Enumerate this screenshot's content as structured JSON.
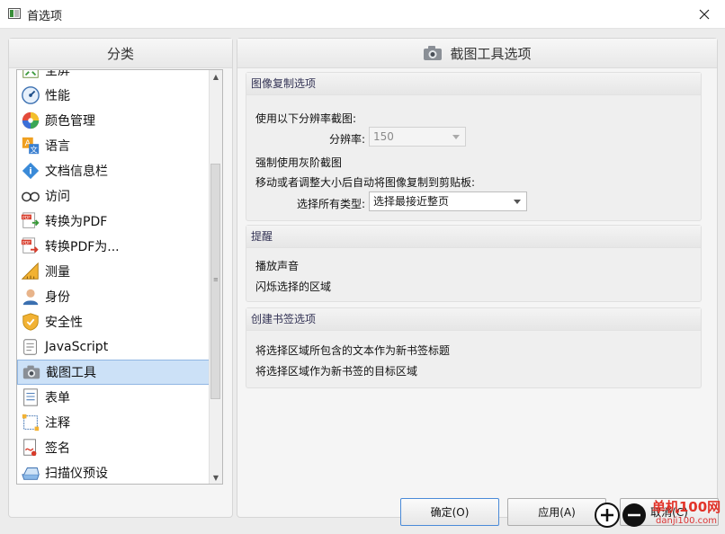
{
  "window": {
    "title": "首选项"
  },
  "left": {
    "header": "分类",
    "items": [
      {
        "label": "全屏",
        "icon": "fullscreen-icon"
      },
      {
        "label": "性能",
        "icon": "gauge-icon"
      },
      {
        "label": "颜色管理",
        "icon": "color-wheel-icon"
      },
      {
        "label": "语言",
        "icon": "language-icon"
      },
      {
        "label": "文档信息栏",
        "icon": "info-icon"
      },
      {
        "label": "访问",
        "icon": "glasses-icon"
      },
      {
        "label": "转换为PDF",
        "icon": "pdf-convert-icon"
      },
      {
        "label": "转换PDF为...",
        "icon": "pdf-export-icon"
      },
      {
        "label": "测量",
        "icon": "ruler-icon"
      },
      {
        "label": "身份",
        "icon": "user-icon"
      },
      {
        "label": "安全性",
        "icon": "shield-icon"
      },
      {
        "label": "JavaScript",
        "icon": "script-icon"
      },
      {
        "label": "截图工具",
        "icon": "camera-icon",
        "selected": true
      },
      {
        "label": "表单",
        "icon": "form-icon"
      },
      {
        "label": "注释",
        "icon": "comment-icon"
      },
      {
        "label": "签名",
        "icon": "signature-icon"
      },
      {
        "label": "扫描仪预设",
        "icon": "scanner-icon"
      }
    ]
  },
  "right": {
    "header": "截图工具选项",
    "copy_section": {
      "title": "图像复制选项",
      "resolution_intro": "使用以下分辨率截图:",
      "resolution_label": "分辨率:",
      "resolution_value": "150",
      "grayscale": "强制使用灰阶截图",
      "auto_copy": "移动或者调整大小后自动将图像复制到剪贴板:",
      "type_label": "选择所有类型:",
      "type_value": "选择最接近整页"
    },
    "alert_section": {
      "title": "提醒",
      "play_sound": "播放声音",
      "flash_area": "闪烁选择的区域"
    },
    "bookmark_section": {
      "title": "创建书签选项",
      "text_as_title": "将选择区域所包含的文本作为新书签标题",
      "area_as_target": "将选择区域作为新书签的目标区域"
    }
  },
  "buttons": {
    "ok": "确定(O)",
    "apply": "应用(A)",
    "cancel": "取消(C)"
  },
  "watermark": {
    "line1": "单机100网",
    "line2": "danji100.com"
  }
}
